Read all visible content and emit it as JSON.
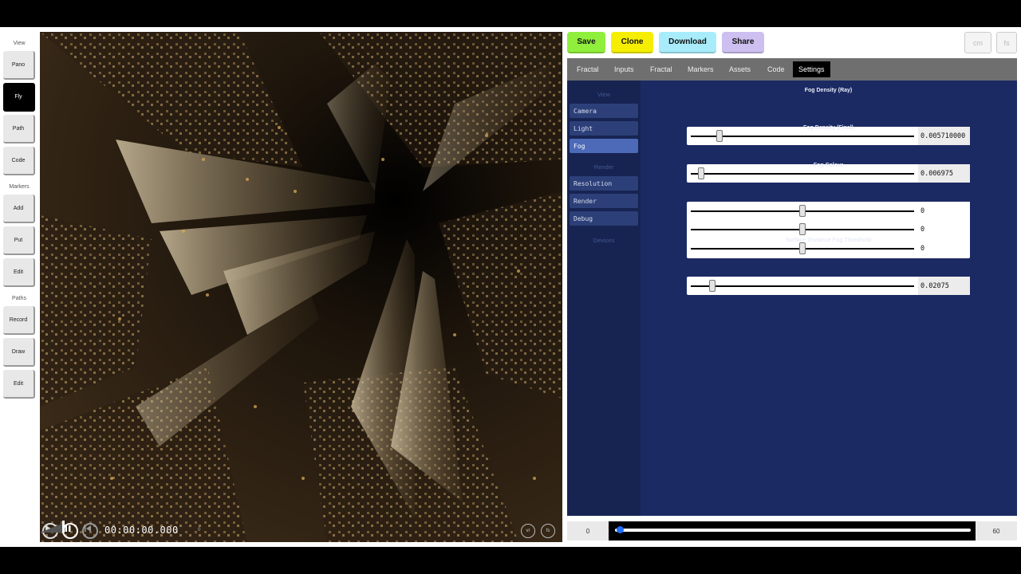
{
  "left_toolbar": {
    "view_label": "View",
    "view_buttons": [
      "Pano",
      "Fly",
      "Path",
      "Code"
    ],
    "markers_label": "Markers",
    "markers_buttons": [
      "Add",
      "Put",
      "Edit"
    ],
    "paths_label": "Paths",
    "paths_buttons": [
      "Record",
      "Draw",
      "Edit"
    ],
    "active": "Fly"
  },
  "player": {
    "timecode": "00:00:00.000",
    "frame": "0",
    "vr_label": "vr",
    "fs_label": "fs"
  },
  "top_actions": {
    "save": "Save",
    "clone": "Clone",
    "download": "Download",
    "share": "Share",
    "cm": "cm",
    "fs": "fs",
    "colors": {
      "save": "#90ee3c",
      "clone": "#f5ee00",
      "download": "#a8ecfb",
      "share": "#cdbff0"
    }
  },
  "tabs": [
    "Fractal",
    "Inputs",
    "Fractal",
    "Markers",
    "Assets",
    "Code",
    "Settings"
  ],
  "active_tab": "Settings",
  "settings_nav": {
    "view_head": "View",
    "view_items": [
      "Camera",
      "Light",
      "Fog"
    ],
    "render_head": "Render",
    "render_items": [
      "Resolution",
      "Render",
      "Debug"
    ],
    "devices_head": "Devices",
    "active": "Fog"
  },
  "fog": {
    "density_ray": {
      "label": "Fog Density (Ray)",
      "value": "0.005710000",
      "level": 0.13
    },
    "density_final": {
      "label": "Fog Density (Final)",
      "value": "0.006975",
      "level": 0.045
    },
    "colour": {
      "label": "Fog Colour",
      "values": [
        "0",
        "0",
        "0"
      ],
      "levels": [
        0.5,
        0.5,
        0.5
      ]
    },
    "surface_threshold": {
      "label": "Surface Distance Fog Threshold",
      "value": "0.02075",
      "level": 0.095
    }
  },
  "timeline": {
    "start": "0",
    "end": "60",
    "position": 0
  }
}
